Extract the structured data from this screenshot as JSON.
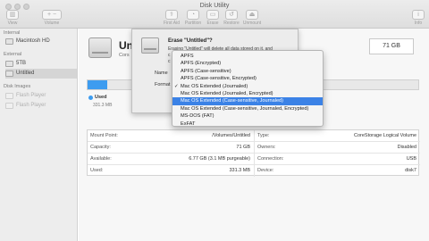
{
  "window": {
    "title": "Disk Utility"
  },
  "toolbar": {
    "view": "View",
    "volume": "Volume",
    "first_aid": "First Aid",
    "partition": "Partition",
    "erase": "Erase",
    "restore": "Restore",
    "unmount": "Unmount",
    "info": "Info"
  },
  "sidebar": {
    "internal": "Internal",
    "macintosh_hd": "Macintosh HD",
    "external": "External",
    "five_tb": "5TB",
    "untitled": "Untitled",
    "disk_images": "Disk Images",
    "flash_player_1": "Flash Player",
    "flash_player_2": "Flash Player"
  },
  "main": {
    "disk_name": "Unt",
    "disk_sub": "Cors",
    "size": "71 GB",
    "used_label": "Used",
    "used_value": "331.3 MB",
    "used_fraction": 0.06
  },
  "info": {
    "mount_point_label": "Mount Point:",
    "mount_point_value": "/Volumes/Untitled",
    "type_label": "Type:",
    "type_value": "CoreStorage Logical Volume",
    "capacity_label": "Capacity:",
    "capacity_value": "71 GB",
    "owners_label": "Owners:",
    "owners_value": "Disabled",
    "available_label": "Available:",
    "available_value": "6.77 GB (3.1 MB purgeable)",
    "connection_label": "Connection:",
    "connection_value": "USB",
    "used_label": "Used:",
    "used_value": "331.3 MB",
    "device_label": "Device:",
    "device_value": "disk7"
  },
  "sheet": {
    "title": "Erase \"Untitled\"?",
    "desc_line1": "Erasing \"Untitled\" will delete all data stored on it, and",
    "desc_line2": "c",
    "desc_line3": "c",
    "name_label": "Name",
    "format_label": "Format"
  },
  "menu": {
    "items": [
      {
        "label": "APFS",
        "checked": false,
        "highlighted": false
      },
      {
        "label": "APFS (Encrypted)",
        "checked": false,
        "highlighted": false
      },
      {
        "label": "APFS (Case-sensitive)",
        "checked": false,
        "highlighted": false
      },
      {
        "label": "APFS (Case-sensitive, Encrypted)",
        "checked": false,
        "highlighted": false
      },
      {
        "label": "Mac OS Extended (Journaled)",
        "checked": true,
        "highlighted": false
      },
      {
        "label": "Mac OS Extended (Journaled, Encrypted)",
        "checked": false,
        "highlighted": false
      },
      {
        "label": "Mac OS Extended (Case-sensitive, Journaled)",
        "checked": false,
        "highlighted": true
      },
      {
        "label": "Mac OS Extended (Case-sensitive, Journaled, Encrypted)",
        "checked": false,
        "highlighted": false
      },
      {
        "label": "MS-DOS (FAT)",
        "checked": false,
        "highlighted": false
      },
      {
        "label": "ExFAT",
        "checked": false,
        "highlighted": false
      }
    ],
    "checkmark": "✓"
  },
  "colors": {
    "accent": "#3b82e6",
    "used": "#3d9cf0"
  }
}
